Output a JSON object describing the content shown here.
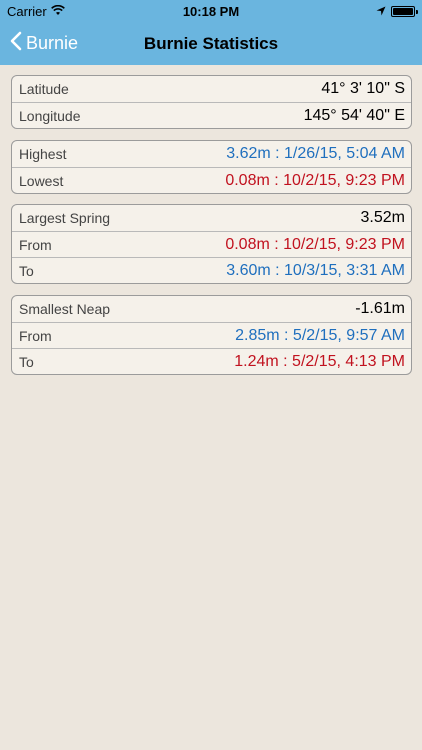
{
  "status_bar": {
    "carrier": "Carrier",
    "time": "10:18 PM"
  },
  "nav": {
    "back_label": "Burnie",
    "title": "Burnie Statistics"
  },
  "location": {
    "latitude_label": "Latitude",
    "latitude_value": "41° 3' 10\" S",
    "longitude_label": "Longitude",
    "longitude_value": "145° 54' 40\" E"
  },
  "extremes": {
    "highest_label": "Highest",
    "highest_value": "3.62m : 1/26/15, 5:04 AM",
    "lowest_label": "Lowest",
    "lowest_value": "0.08m : 10/2/15, 9:23 PM"
  },
  "spring": {
    "label": "Largest Spring",
    "value": "3.52m",
    "from_label": "From",
    "from_value": "0.08m : 10/2/15, 9:23 PM",
    "to_label": "To",
    "to_value": "3.60m : 10/3/15, 3:31 AM"
  },
  "neap": {
    "label": "Smallest Neap",
    "value": "-1.61m",
    "from_label": "From",
    "from_value": "2.85m : 5/2/15, 9:57 AM",
    "to_label": "To",
    "to_value": "1.24m : 5/2/15, 4:13 PM"
  },
  "colors": {
    "header": "#6ab5df",
    "background": "#ece6dd",
    "high_blue": "#1f6fbe",
    "low_red": "#c1121f"
  },
  "icons": [
    "wifi-icon",
    "location-arrow-icon",
    "battery-icon",
    "chevron-left-icon"
  ]
}
